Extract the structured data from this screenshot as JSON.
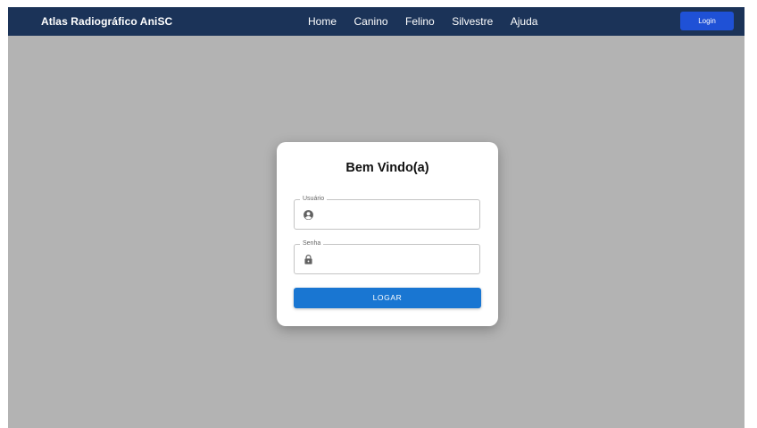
{
  "navbar": {
    "brand": "Atlas Radiográfico AniSC",
    "links": [
      {
        "label": "Home"
      },
      {
        "label": "Canino"
      },
      {
        "label": "Felino"
      },
      {
        "label": "Silvestre"
      },
      {
        "label": "Ajuda"
      }
    ],
    "login_label": "Login"
  },
  "login_card": {
    "title": "Bem Vindo(a)",
    "username": {
      "label": "Usuário",
      "value": "",
      "icon": "account-circle-icon"
    },
    "password": {
      "label": "Senha",
      "value": "",
      "icon": "lock-icon"
    },
    "submit_label": "LOGAR"
  },
  "colors": {
    "navbar_bg": "#1b3358",
    "login_button": "#1f51d6",
    "submit_button": "#1976d2",
    "backdrop": "#b3b3b3"
  }
}
